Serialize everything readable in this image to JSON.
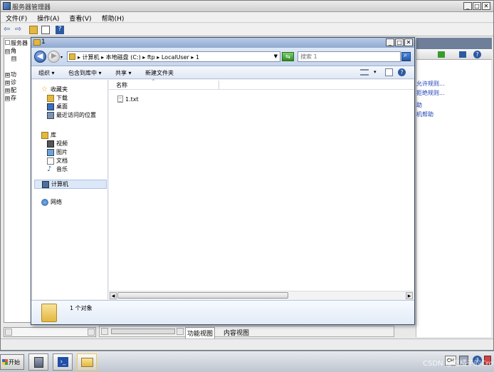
{
  "server_manager": {
    "title": "服务器管理器",
    "menu": [
      "文件(F)",
      "操作(A)",
      "查看(V)",
      "帮助(H)"
    ],
    "tree": [
      {
        "expander": "",
        "label": "服务器"
      },
      {
        "expander": "⊟",
        "label": "角"
      },
      {
        "expander": "⊟",
        "label": ""
      },
      {
        "expander": "⊞",
        "label": "功"
      },
      {
        "expander": "⊞",
        "label": "诊"
      },
      {
        "expander": "⊞",
        "label": "配"
      },
      {
        "expander": "⊞",
        "label": "存"
      }
    ],
    "actions": [
      "允许规则...",
      "拒绝规则...",
      "助",
      "机帮助"
    ],
    "view_tabs": {
      "function_view": "功能视图",
      "content_view": "内容视图"
    }
  },
  "explorer": {
    "title": "1",
    "breadcrumb": [
      "计算机",
      "本地磁盘 (C:)",
      "ftp",
      "LocalUser",
      "1"
    ],
    "search_placeholder": "搜索 1",
    "toolbar": {
      "organize": "组织 ▾",
      "include_in_library": "包含到库中 ▾",
      "share": "共享 ▾",
      "new_folder": "新建文件夹"
    },
    "nav": {
      "favorites": "收藏夹",
      "downloads": "下载",
      "desktop": "桌面",
      "recent": "最近访问的位置",
      "libraries": "库",
      "videos": "视频",
      "pictures": "图片",
      "documents": "文档",
      "music": "音乐",
      "computer": "计算机",
      "network": "网络"
    },
    "column_header": "名称",
    "files": [
      {
        "name": "1.txt"
      }
    ],
    "details": {
      "count": "1 个对象"
    }
  },
  "taskbar": {
    "start": "开始",
    "tray_lang": "CH",
    "watermark": "CSDN @吃橘子的Crow"
  },
  "colors": {
    "accent": "#2856a6",
    "link": "#1b3fb5",
    "folder": "#e4b740"
  }
}
